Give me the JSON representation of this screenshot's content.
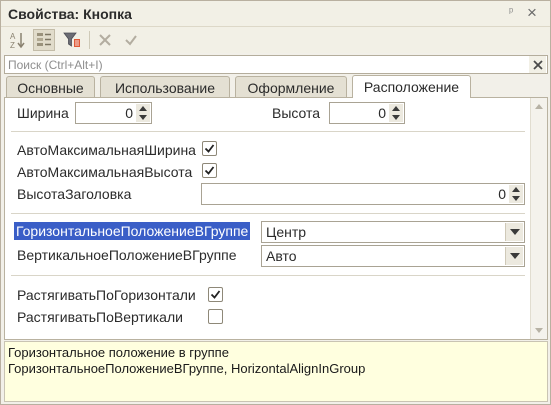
{
  "window": {
    "title": "Свойства: Кнопка"
  },
  "search": {
    "placeholder": "Поиск (Ctrl+Alt+I)",
    "value": ""
  },
  "tabs": [
    {
      "label": "Основные"
    },
    {
      "label": "Использование"
    },
    {
      "label": "Оформление"
    },
    {
      "label": "Расположение",
      "active": true
    }
  ],
  "properties": {
    "width_label": "Ширина",
    "width_value": "0",
    "height_label": "Высота",
    "height_value": "0",
    "auto_max_width_label": "АвтоМаксимальнаяШирина",
    "auto_max_width_checked": true,
    "auto_max_height_label": "АвтоМаксимальнаяВысота",
    "auto_max_height_checked": true,
    "title_height_label": "ВысотаЗаголовка",
    "title_height_value": "0",
    "h_position_label": "ГоризонтальноеПоложениеВГруппе",
    "h_position_value": "Центр",
    "v_position_label": "ВертикальноеПоложениеВГруппе",
    "v_position_value": "Авто",
    "stretch_h_label": "РастягиватьПоГоризонтали",
    "stretch_h_checked": true,
    "stretch_v_label": "РастягиватьПоВертикали",
    "stretch_v_checked": false
  },
  "description": {
    "line1": "Горизонтальное положение в группе",
    "line2": "ГоризонтальноеПоложениеВГруппе, HorizontalAlignInGroup"
  },
  "colors": {
    "selection": "#3a5ec7",
    "description_bg": "#ffffdf",
    "window_bg": "#f2f0e9"
  }
}
